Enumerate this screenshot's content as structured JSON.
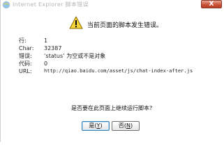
{
  "window": {
    "title": "Internet Explorer 脚本错误",
    "close_label": "X"
  },
  "message": "当前页面的脚本发生错误。",
  "details": [
    {
      "label": "行:",
      "value": "1"
    },
    {
      "label": "Char:",
      "value": "32387"
    },
    {
      "label": "错误:",
      "value": "‘status’ 为空或不是对象"
    },
    {
      "label": "代码:",
      "value": "0"
    },
    {
      "label": "URL:",
      "value": "http://qiao.baidu.com/asset/js/chat-index-after.js"
    }
  ],
  "question": "是否要在此页面上继续运行脚本?",
  "buttons": {
    "yes_label": "是(",
    "yes_key": "Y",
    "yes_close": ")",
    "no_label": "否(",
    "no_key": "N",
    "no_close": ")"
  },
  "colors": {
    "close_button": "#c9543a",
    "warning_yellow": "#f5d238"
  },
  "icons": {
    "title": "ie-globe-icon",
    "message": "warning-icon"
  }
}
